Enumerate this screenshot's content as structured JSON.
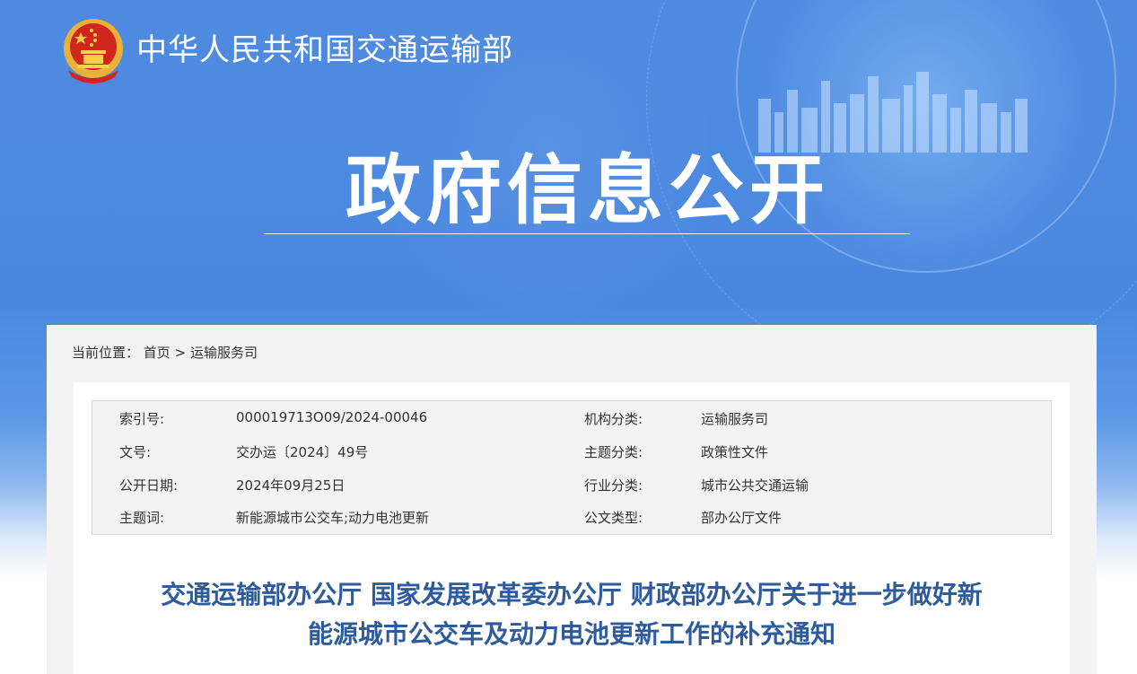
{
  "header": {
    "ministry_name": "中华人民共和国交通运输部",
    "section_title": "政府信息公开"
  },
  "breadcrumb": {
    "label": "当前位置：",
    "home": "首页",
    "separator": ">",
    "current": "运输服务司"
  },
  "meta": {
    "rows": [
      {
        "k1": "索引号:",
        "v1": "000019713O09/2024-00046",
        "k2": "机构分类:",
        "v2": "运输服务司"
      },
      {
        "k1": "文号:",
        "v1": "交办运〔2024〕49号",
        "k2": "主题分类:",
        "v2": "政策性文件"
      },
      {
        "k1": "公开日期:",
        "v1": "2024年09月25日",
        "k2": "行业分类:",
        "v2": "城市公共交通运输"
      },
      {
        "k1": "主题词:",
        "v1": "新能源城市公交车;动力电池更新",
        "k2": "公文类型:",
        "v2": "部办公厅文件"
      }
    ]
  },
  "document": {
    "title_line1": "交通运输部办公厅 国家发展改革委办公厅 财政部办公厅关于进一步做好新",
    "title_line2": "能源城市公交车及动力电池更新工作的补充通知"
  },
  "colors": {
    "banner_blue": "#4a88e0",
    "title_blue": "#2d5b9c",
    "panel_gray": "#f3f3f3"
  }
}
